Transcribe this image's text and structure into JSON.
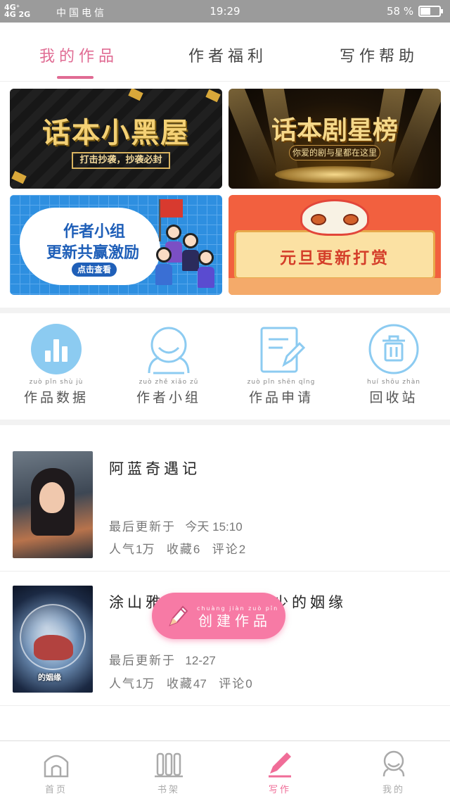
{
  "status_bar": {
    "signal_1": "4G⁺",
    "signal_2": "4G 2G",
    "carrier": "中国电信",
    "time": "19:29",
    "battery": "58 %",
    "battery_level": 0.58
  },
  "tabs": [
    {
      "label": "我的作品",
      "active": true
    },
    {
      "label": "作者福利",
      "active": false
    },
    {
      "label": "写作帮助",
      "active": false
    }
  ],
  "banners": [
    {
      "title": "话本小黑屋",
      "subtitle": "打击抄袭，抄袭必封"
    },
    {
      "title": "话本剧星榜",
      "subtitle": "你爱的剧与星都在这里"
    },
    {
      "title_line1": "作者小组",
      "title_line2": "更新共赢激励",
      "button": "点击查看"
    },
    {
      "title": "元旦更新打赏"
    }
  ],
  "functions": [
    {
      "label": "作品数据",
      "pinyin": "zuò pǐn shù jù",
      "icon": "bar-chart-icon"
    },
    {
      "label": "作者小组",
      "pinyin": "zuò zhě xiǎo zǔ",
      "icon": "group-icon"
    },
    {
      "label": "作品申请",
      "pinyin": "zuò pǐn shēn qǐng",
      "icon": "edit-document-icon"
    },
    {
      "label": "回收站",
      "pinyin": "huí shōu zhàn",
      "icon": "trash-icon"
    }
  ],
  "works": [
    {
      "title": "阿蓝奇遇记",
      "updated_label": "最后更新于",
      "updated_value": "今天 15:10",
      "popularity_label": "人气",
      "popularity": "1万",
      "favorites_label": "收藏",
      "favorites": "6",
      "comments_label": "评论",
      "comments": "2"
    },
    {
      "title": "涂山雅雅与傲来国三少的姻缘",
      "cover_text": "的姻缘",
      "updated_label": "最后更新于",
      "updated_value": "12-27",
      "popularity_label": "人气",
      "popularity": "1万",
      "favorites_label": "收藏",
      "favorites": "47",
      "comments_label": "评论",
      "comments": "0"
    }
  ],
  "fab": {
    "label": "创建作品",
    "pinyin": "chuàng jiàn zuò pǐn"
  },
  "bottom_nav": [
    {
      "label": "首页",
      "active": false
    },
    {
      "label": "书架",
      "active": false
    },
    {
      "label": "写作",
      "active": true
    },
    {
      "label": "我的",
      "active": false
    }
  ],
  "colors": {
    "accent": "#e06b93",
    "fab": "#f77aa5",
    "icon_blue": "#8ccbf1",
    "status_bar": "#9b9b9b"
  }
}
